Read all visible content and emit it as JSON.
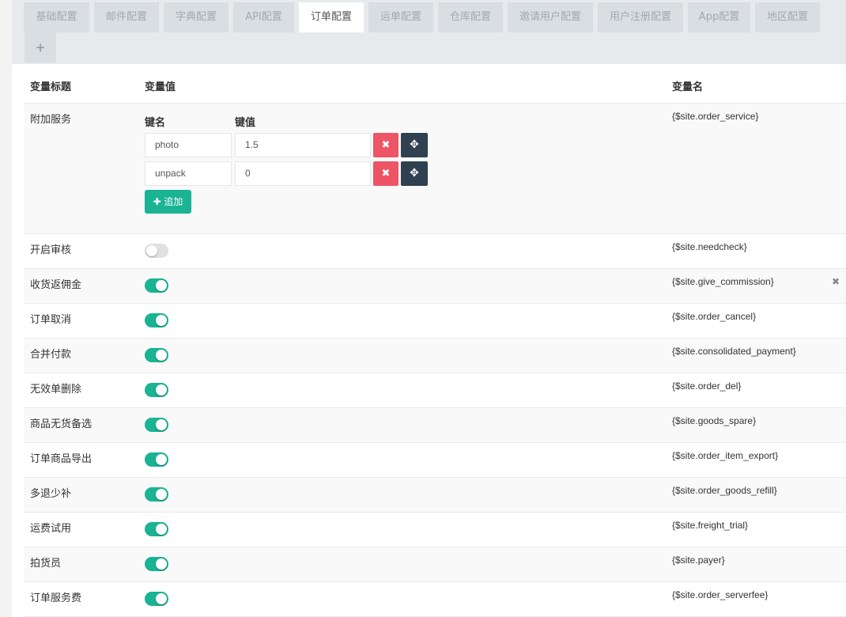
{
  "tabs": [
    {
      "label": "基础配置"
    },
    {
      "label": "邮件配置"
    },
    {
      "label": "字典配置"
    },
    {
      "label": "API配置"
    },
    {
      "label": "订单配置"
    },
    {
      "label": "运单配置"
    },
    {
      "label": "仓库配置"
    },
    {
      "label": "邀请用户配置"
    },
    {
      "label": "用户注册配置"
    },
    {
      "label": "App配置"
    },
    {
      "label": "地区配置"
    }
  ],
  "add_tab_label": "+",
  "active_tab": "订单配置",
  "table": {
    "headers": {
      "title": "变量标题",
      "value": "变量值",
      "name": "变量名"
    }
  },
  "service": {
    "title": "附加服务",
    "var": "{$site.order_service}",
    "key_header": "键名",
    "value_header": "键值",
    "entries": [
      {
        "key": "photo",
        "value": "1.5"
      },
      {
        "key": "unpack",
        "value": "0"
      }
    ],
    "remove_icon": "✖",
    "move_icon": "✥",
    "add_label": "✚ 追加"
  },
  "rows": [
    {
      "title": "开启审核",
      "var": "{$site.needcheck}",
      "enabled": false
    },
    {
      "title": "收货返佣金",
      "var": "{$site.give_commission}",
      "enabled": true,
      "delete_icon": "✖"
    },
    {
      "title": "订单取消",
      "var": "{$site.order_cancel}",
      "enabled": true
    },
    {
      "title": "合并付款",
      "var": "{$site.consolidated_payment}",
      "enabled": true
    },
    {
      "title": "无效单删除",
      "var": "{$site.order_del}",
      "enabled": true
    },
    {
      "title": "商品无货备选",
      "var": "{$site.goods_spare}",
      "enabled": true
    },
    {
      "title": "订单商品导出",
      "var": "{$site.order_item_export}",
      "enabled": true
    },
    {
      "title": "多退少补",
      "var": "{$site.order_goods_refill}",
      "enabled": true
    },
    {
      "title": "运费试用",
      "var": "{$site.freight_trial}",
      "enabled": true
    },
    {
      "title": "拍货员",
      "var": "{$site.payer}",
      "enabled": true
    },
    {
      "title": "订单服务费",
      "var": "{$site.order_serverfee}",
      "enabled": true
    }
  ],
  "colors": {
    "toggle_on": "#1ab394",
    "danger": "#ed5565",
    "dark": "#2f4050"
  }
}
